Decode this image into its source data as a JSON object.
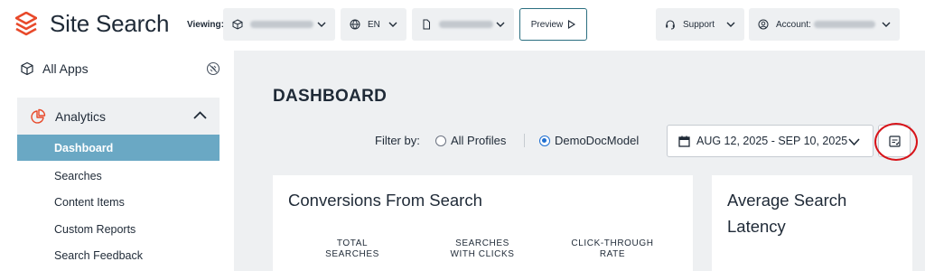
{
  "app": {
    "title": "Site Search"
  },
  "topbar": {
    "viewing_label": "Viewing:",
    "language": "EN",
    "preview_label": "Preview",
    "support_label": "Support",
    "account_label": "Account:"
  },
  "sidebar": {
    "all_apps": "All Apps",
    "section": "Analytics",
    "items": [
      {
        "label": "Dashboard",
        "active": true
      },
      {
        "label": "Searches",
        "active": false
      },
      {
        "label": "Content Items",
        "active": false
      },
      {
        "label": "Custom Reports",
        "active": false
      },
      {
        "label": "Search Feedback",
        "active": false
      }
    ]
  },
  "main": {
    "page_title": "DASHBOARD",
    "filter_label": "Filter by:",
    "filter_options": [
      {
        "label": "All Profiles",
        "selected": false
      },
      {
        "label": "DemoDocModel",
        "selected": true
      }
    ],
    "date_range": "AUG 12, 2025 - SEP 10, 2025",
    "cards": [
      {
        "title": "Conversions From Search",
        "metrics": [
          {
            "line1": "TOTAL",
            "line2": "SEARCHES"
          },
          {
            "line1": "SEARCHES",
            "line2": "WITH CLICKS"
          },
          {
            "line1": "CLICK-THROUGH",
            "line2": "RATE"
          }
        ]
      },
      {
        "title": "Average Search Latency"
      }
    ]
  },
  "colors": {
    "brand": "#e8492a",
    "active_nav": "#6aa8c4",
    "highlight": "#d7141a",
    "radio": "#1f6fd1"
  }
}
